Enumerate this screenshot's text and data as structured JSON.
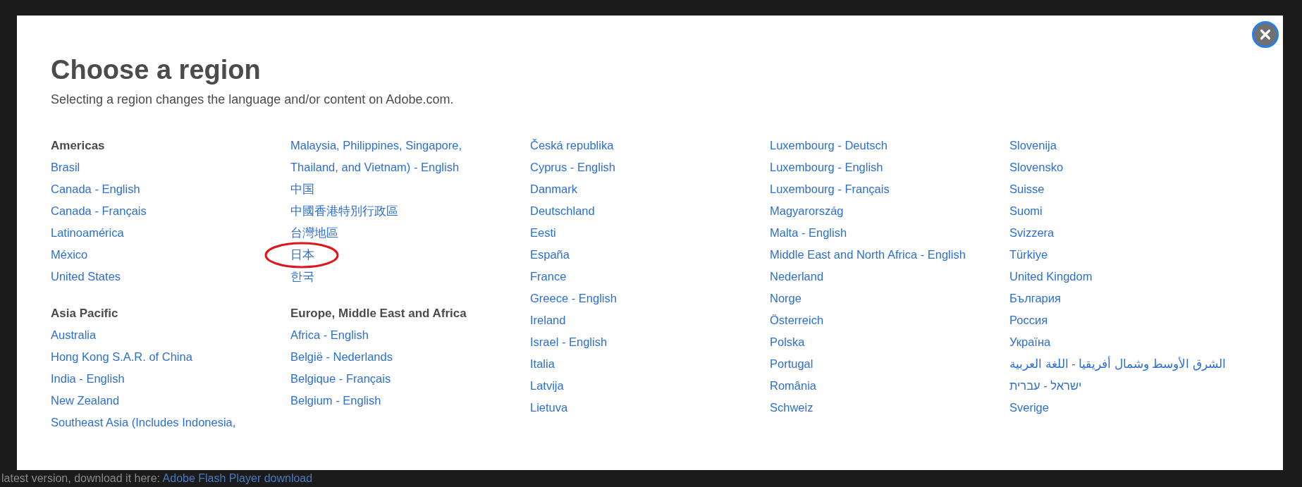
{
  "dialog": {
    "title": "Choose a region",
    "subtitle": "Selecting a region changes the language and/or content on Adobe.com.",
    "columns": [
      {
        "groups": [
          {
            "heading": "Americas",
            "links": [
              {
                "label": "Brasil",
                "circled": false
              },
              {
                "label": "Canada - English",
                "circled": false
              },
              {
                "label": "Canada - Français",
                "circled": false
              },
              {
                "label": "Latinoamérica",
                "circled": false
              },
              {
                "label": "México",
                "circled": false
              },
              {
                "label": "United States",
                "circled": false
              }
            ]
          },
          {
            "heading": "Asia Pacific",
            "links": [
              {
                "label": "Australia",
                "circled": false
              },
              {
                "label": "Hong Kong S.A.R. of China",
                "circled": false
              },
              {
                "label": "India - English",
                "circled": false
              },
              {
                "label": "New Zealand",
                "circled": false
              },
              {
                "label": "Southeast Asia (Includes Indonesia,",
                "circled": false
              }
            ]
          }
        ]
      },
      {
        "groups": [
          {
            "links": [
              {
                "label": "Malaysia, Philippines, Singapore, Thailand, and Vietnam) - English",
                "circled": false
              },
              {
                "label": "中国",
                "circled": false
              },
              {
                "label": "中國香港特別行政區",
                "circled": false
              },
              {
                "label": "台灣地區",
                "circled": false
              },
              {
                "label": "日本",
                "circled": true
              },
              {
                "label": "한국",
                "circled": false
              }
            ]
          },
          {
            "heading": "Europe, Middle East and Africa",
            "links": [
              {
                "label": "Africa - English",
                "circled": false
              },
              {
                "label": "België - Nederlands",
                "circled": false
              },
              {
                "label": "Belgique - Français",
                "circled": false
              },
              {
                "label": "Belgium - English",
                "circled": false
              }
            ]
          }
        ]
      },
      {
        "groups": [
          {
            "links": [
              {
                "label": "Česká republika",
                "circled": false
              },
              {
                "label": "Cyprus - English",
                "circled": false
              },
              {
                "label": "Danmark",
                "circled": false
              },
              {
                "label": "Deutschland",
                "circled": false
              },
              {
                "label": "Eesti",
                "circled": false
              },
              {
                "label": "España",
                "circled": false
              },
              {
                "label": "France",
                "circled": false
              },
              {
                "label": "Greece - English",
                "circled": false
              },
              {
                "label": "Ireland",
                "circled": false
              },
              {
                "label": "Israel - English",
                "circled": false
              },
              {
                "label": "Italia",
                "circled": false
              },
              {
                "label": "Latvija",
                "circled": false
              },
              {
                "label": "Lietuva",
                "circled": false
              }
            ]
          }
        ]
      },
      {
        "groups": [
          {
            "links": [
              {
                "label": "Luxembourg - Deutsch",
                "circled": false
              },
              {
                "label": "Luxembourg - English",
                "circled": false
              },
              {
                "label": "Luxembourg - Français",
                "circled": false
              },
              {
                "label": "Magyarország",
                "circled": false
              },
              {
                "label": "Malta - English",
                "circled": false
              },
              {
                "label": "Middle East and North Africa - English",
                "circled": false
              },
              {
                "label": "Nederland",
                "circled": false
              },
              {
                "label": "Norge",
                "circled": false
              },
              {
                "label": "Österreich",
                "circled": false
              },
              {
                "label": "Polska",
                "circled": false
              },
              {
                "label": "Portugal",
                "circled": false
              },
              {
                "label": "România",
                "circled": false
              },
              {
                "label": "Schweiz",
                "circled": false
              }
            ]
          }
        ]
      },
      {
        "groups": [
          {
            "links": [
              {
                "label": "Slovenija",
                "circled": false
              },
              {
                "label": "Slovensko",
                "circled": false
              },
              {
                "label": "Suisse",
                "circled": false
              },
              {
                "label": "Suomi",
                "circled": false
              },
              {
                "label": "Svizzera",
                "circled": false
              },
              {
                "label": "Türkiye",
                "circled": false
              },
              {
                "label": "United Kingdom",
                "circled": false
              },
              {
                "label": "България",
                "circled": false
              },
              {
                "label": "Россия",
                "circled": false
              },
              {
                "label": "Україна",
                "circled": false
              },
              {
                "label": "الشرق الأوسط وشمال أفريقيا - اللغة العربية",
                "circled": false
              },
              {
                "label": "ישראל - עברית",
                "circled": false
              },
              {
                "label": "Sverige",
                "circled": false
              }
            ]
          }
        ]
      }
    ]
  },
  "page_behind": {
    "text": "latest version, download it here:",
    "link": "Adobe Flash Player download"
  }
}
